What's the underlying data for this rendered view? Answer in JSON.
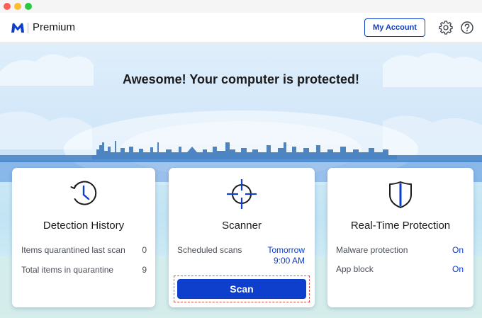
{
  "window": {
    "traffic_lights": [
      "close",
      "minimize",
      "zoom"
    ]
  },
  "header": {
    "product_name": "Premium",
    "my_account_label": "My Account",
    "icons": [
      "malwarebytes-logo-icon",
      "gear-icon",
      "help-icon"
    ]
  },
  "hero": {
    "headline": "Awesome! Your computer is protected!"
  },
  "cards": {
    "detection_history": {
      "title": "Detection History",
      "icon": "clock-history-icon",
      "rows": [
        {
          "label": "Items quarantined last scan",
          "value": "0"
        },
        {
          "label": "Total items in quarantine",
          "value": "9"
        }
      ]
    },
    "scanner": {
      "title": "Scanner",
      "icon": "crosshair-icon",
      "scheduled_label": "Scheduled scans",
      "scheduled_day": "Tomorrow",
      "scheduled_time": "9:00 AM",
      "scan_button": "Scan"
    },
    "realtime": {
      "title": "Real-Time Protection",
      "icon": "shield-icon",
      "rows": [
        {
          "label": "Malware protection",
          "value": "On"
        },
        {
          "label": "App block",
          "value": "On"
        }
      ]
    }
  },
  "colors": {
    "accent": "#0d3ecc",
    "text": "#1b1b1b",
    "muted": "#4a4f57",
    "sky": "#c4e0f8"
  }
}
